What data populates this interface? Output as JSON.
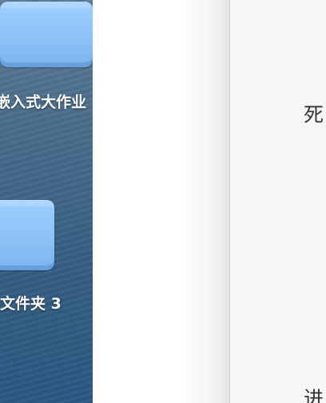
{
  "desktop": {
    "items": [
      {
        "label": "嵌入式大作业"
      },
      {
        "label": "文件夹 3"
      }
    ]
  },
  "document": {
    "lines": [
      "死",
      "进"
    ]
  }
}
